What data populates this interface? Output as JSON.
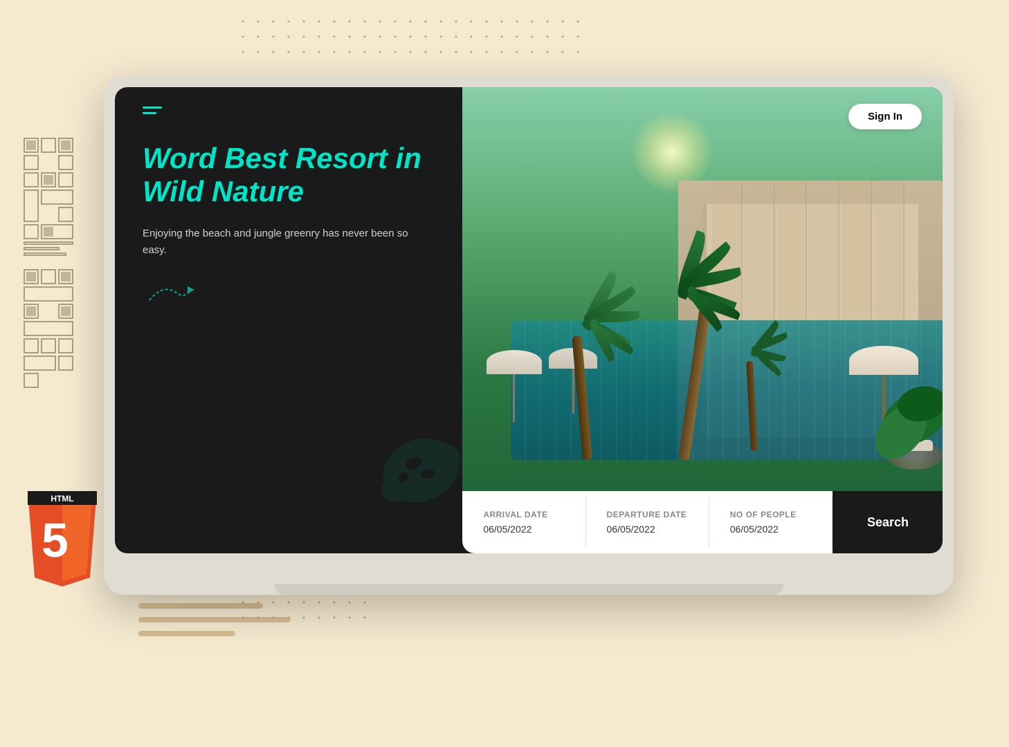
{
  "page": {
    "background_color": "#f5e9d0"
  },
  "header": {
    "signin_label": "Sign In"
  },
  "hero": {
    "headline": "Word Best Resort in Wild Nature",
    "subtext": "Enjoying the beach and jungle greenry has never been so easy.",
    "menu_icon": "hamburger-menu"
  },
  "search": {
    "arrival_label": "Arrival Date",
    "arrival_value": "06/05/2022",
    "departure_label": "Departure Date",
    "departure_value": "06/05/2022",
    "people_label": "No of people",
    "people_value": "06/05/2022",
    "button_label": "Search"
  },
  "decorative": {
    "arrow_symbol": "⟳→",
    "monstera_opacity": 0.15
  }
}
